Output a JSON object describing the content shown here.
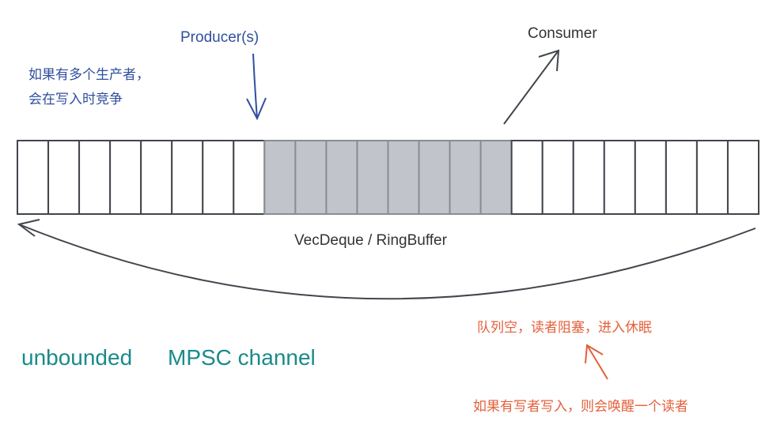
{
  "producer_label": "Producer(s)",
  "producer_note": [
    "如果有多个生产者，",
    "会在写入时竞争"
  ],
  "consumer_label": "Consumer",
  "buffer_label": "VecDeque / RingBuffer",
  "buffer": {
    "cells_before": 8,
    "filled_cells": 8,
    "cells_after": 8
  },
  "channel_title": [
    "unbounded",
    "MPSC channel"
  ],
  "empty_note": "队列空，读者阻塞，进入休眠",
  "wake_note": "如果有写者写入，则会唤醒一个读者",
  "colors": {
    "producer": "#2f4f9e",
    "title": "#1a8a8a",
    "note": "#e5603b",
    "filled": "#c1c4ca",
    "stroke": "#41454c"
  }
}
